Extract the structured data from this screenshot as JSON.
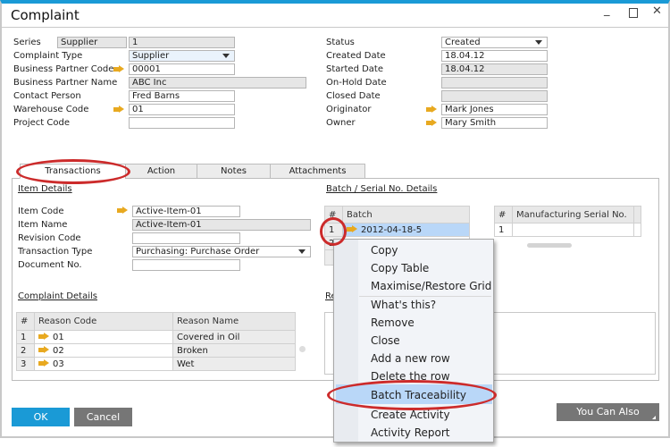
{
  "window": {
    "title": "Complaint",
    "controls": [
      "minimize",
      "maximize",
      "close"
    ]
  },
  "header_left": [
    {
      "label": "Series",
      "value": "1",
      "prefix": "Supplier"
    },
    {
      "label": "Complaint Type",
      "value": "Supplier"
    },
    {
      "label": "Business Partner Code",
      "value": "00001"
    },
    {
      "label": "Business Partner Name",
      "value": "ABC Inc"
    },
    {
      "label": "Contact Person",
      "value": "Fred Barns"
    },
    {
      "label": "Warehouse Code",
      "value": "01"
    },
    {
      "label": "Project Code",
      "value": ""
    }
  ],
  "header_right": [
    {
      "label": "Status",
      "value": "Created"
    },
    {
      "label": "Created Date",
      "value": "18.04.12"
    },
    {
      "label": "Started Date",
      "value": "18.04.12"
    },
    {
      "label": "On-Hold Date",
      "value": ""
    },
    {
      "label": "Closed Date",
      "value": ""
    },
    {
      "label": "Originator",
      "value": "Mark Jones"
    },
    {
      "label": "Owner",
      "value": "Mary Smith"
    }
  ],
  "tabs": [
    {
      "label": "Transactions",
      "selected": true
    },
    {
      "label": "Action"
    },
    {
      "label": "Notes"
    },
    {
      "label": "Attachments"
    }
  ],
  "item_details": {
    "title": "Item Details",
    "fields": [
      {
        "label": "Item Code",
        "value": "Active-Item-01"
      },
      {
        "label": "Item Name",
        "value": "Active-Item-01"
      },
      {
        "label": "Revision Code",
        "value": ""
      },
      {
        "label": "Transaction Type",
        "value": "Purchasing: Purchase Order"
      },
      {
        "label": "Document No.",
        "value": ""
      }
    ]
  },
  "complaint_details": {
    "title": "Complaint Details",
    "columns": [
      "#",
      "Reason Code",
      "Reason Name"
    ],
    "rows": [
      [
        "1",
        "01",
        "Covered in Oil"
      ],
      [
        "2",
        "02",
        "Broken"
      ],
      [
        "3",
        "03",
        "Wet"
      ]
    ]
  },
  "batch_details": {
    "title": "Batch / Serial No. Details",
    "columns": [
      "#",
      "Batch"
    ],
    "rows": [
      [
        "1",
        "2012-04-18-5"
      ],
      [
        "2",
        ""
      ]
    ],
    "serial_columns": [
      "#",
      "Manufacturing Serial No."
    ],
    "serial_rows": [
      [
        "1",
        ""
      ]
    ]
  },
  "remarks_label": "Re",
  "context_menu": [
    "Copy",
    "Copy Table",
    "Maximise/Restore Grid",
    "What's this?",
    "Remove",
    "Close",
    "Add a new row",
    "Delete the row",
    "Batch Traceability",
    "Create Activity",
    "Activity Report"
  ],
  "context_menu_highlighted": "Batch Traceability",
  "buttons": {
    "ok": "OK",
    "cancel": "Cancel",
    "you_can_also": "You Can Also"
  },
  "colors": {
    "accent": "#1a9ad6",
    "highlight": "#b9d7f8",
    "annotation": "#cc2b2b",
    "link_arrow": "#e8a920"
  }
}
